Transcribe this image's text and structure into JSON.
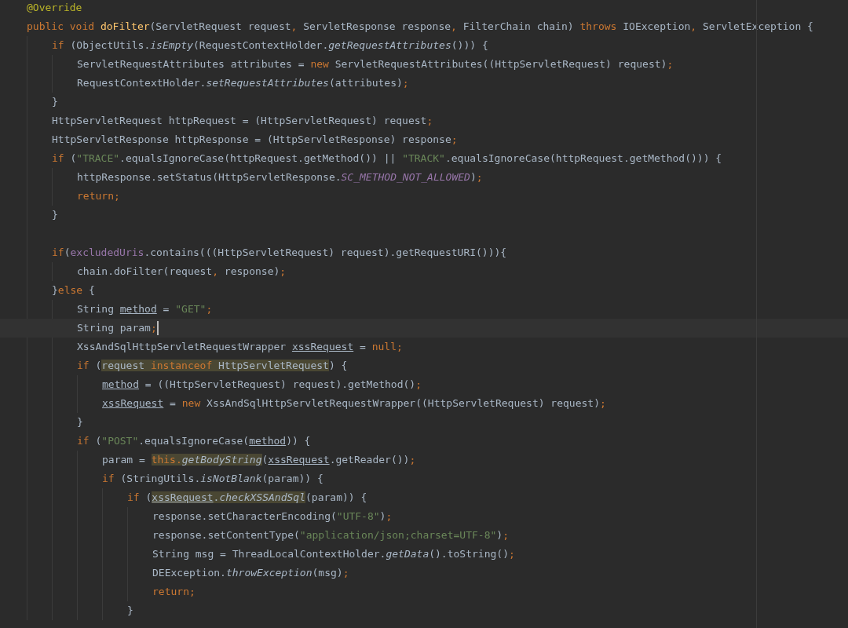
{
  "editor": {
    "lines": [
      {
        "kind": "code",
        "tokens": [
          {
            "text": "@Override",
            "kind": "anno"
          }
        ]
      },
      {
        "kind": "code",
        "tokens": [
          {
            "text": "public void ",
            "kind": "kw"
          },
          {
            "text": "doFilter",
            "kind": "decl"
          },
          {
            "text": "(ServletRequest request",
            "kind": "plain"
          },
          {
            "text": ", ",
            "kind": "punct"
          },
          {
            "text": "ServletResponse response",
            "kind": "plain"
          },
          {
            "text": ", ",
            "kind": "punct"
          },
          {
            "text": "FilterChain chain) ",
            "kind": "plain"
          },
          {
            "text": "throws ",
            "kind": "kw"
          },
          {
            "text": "IOException",
            "kind": "plain"
          },
          {
            "text": ", ",
            "kind": "punct"
          },
          {
            "text": "ServletException {",
            "kind": "plain"
          }
        ],
        "children": [
          {
            "kind": "code",
            "tokens": [
              {
                "text": "if ",
                "kind": "kw"
              },
              {
                "text": "(ObjectUtils.",
                "kind": "plain"
              },
              {
                "text": "isEmpty",
                "kind": "italic"
              },
              {
                "text": "(RequestContextHolder.",
                "kind": "plain"
              },
              {
                "text": "getRequestAttributes",
                "kind": "italic"
              },
              {
                "text": "())) {",
                "kind": "plain"
              }
            ],
            "children": [
              {
                "kind": "code",
                "tokens": [
                  {
                    "text": "ServletRequestAttributes attributes = ",
                    "kind": "plain"
                  },
                  {
                    "text": "new ",
                    "kind": "kw"
                  },
                  {
                    "text": "ServletRequestAttributes((HttpServletRequest) request)",
                    "kind": "plain"
                  },
                  {
                    "text": ";",
                    "kind": "punct"
                  }
                ]
              },
              {
                "kind": "code",
                "tokens": [
                  {
                    "text": "RequestContextHolder.",
                    "kind": "plain"
                  },
                  {
                    "text": "setRequestAttributes",
                    "kind": "italic"
                  },
                  {
                    "text": "(attributes)",
                    "kind": "plain"
                  },
                  {
                    "text": ";",
                    "kind": "punct"
                  }
                ]
              }
            ]
          },
          {
            "kind": "code",
            "tokens": [
              {
                "text": "}",
                "kind": "plain"
              }
            ]
          },
          {
            "kind": "code",
            "tokens": [
              {
                "text": "HttpServletRequest httpRequest = (HttpServletRequest) request",
                "kind": "plain"
              },
              {
                "text": ";",
                "kind": "punct"
              }
            ]
          },
          {
            "kind": "code",
            "tokens": [
              {
                "text": "HttpServletResponse httpResponse = (HttpServletResponse) response",
                "kind": "plain"
              },
              {
                "text": ";",
                "kind": "punct"
              }
            ]
          },
          {
            "kind": "code",
            "tokens": [
              {
                "text": "if ",
                "kind": "kw"
              },
              {
                "text": "(",
                "kind": "plain"
              },
              {
                "text": "\"TRACE\"",
                "kind": "str"
              },
              {
                "text": ".equalsIgnoreCase(httpRequest.getMethod()) || ",
                "kind": "plain"
              },
              {
                "text": "\"TRACK\"",
                "kind": "str"
              },
              {
                "text": ".equalsIgnoreCase(httpRequest.getMethod())) {",
                "kind": "plain"
              }
            ],
            "children": [
              {
                "kind": "code",
                "tokens": [
                  {
                    "text": "httpResponse.setStatus(HttpServletResponse.",
                    "kind": "plain"
                  },
                  {
                    "text": "SC_METHOD_NOT_ALLOWED",
                    "kind": "const"
                  },
                  {
                    "text": ")",
                    "kind": "plain"
                  },
                  {
                    "text": ";",
                    "kind": "punct"
                  }
                ]
              },
              {
                "kind": "code",
                "tokens": [
                  {
                    "text": "return;",
                    "kind": "kw"
                  }
                ]
              }
            ]
          },
          {
            "kind": "code",
            "tokens": [
              {
                "text": "}",
                "kind": "plain"
              }
            ]
          },
          {
            "kind": "blank"
          },
          {
            "kind": "code",
            "tokens": [
              {
                "text": "if",
                "kind": "kw"
              },
              {
                "text": "(",
                "kind": "plain"
              },
              {
                "text": "excludedUris",
                "kind": "field"
              },
              {
                "text": ".contains(((HttpServletRequest) request).getRequestURI())){",
                "kind": "plain"
              }
            ],
            "children": [
              {
                "kind": "code",
                "tokens": [
                  {
                    "text": "chain.doFilter(request",
                    "kind": "plain"
                  },
                  {
                    "text": ", ",
                    "kind": "punct"
                  },
                  {
                    "text": "response)",
                    "kind": "plain"
                  },
                  {
                    "text": ";",
                    "kind": "punct"
                  }
                ]
              }
            ]
          },
          {
            "kind": "code",
            "tokens": [
              {
                "text": "}",
                "kind": "plain"
              },
              {
                "text": "else ",
                "kind": "kw"
              },
              {
                "text": "{",
                "kind": "plain"
              }
            ],
            "children": [
              {
                "kind": "code",
                "tokens": [
                  {
                    "text": "String ",
                    "kind": "plain"
                  },
                  {
                    "text": "method",
                    "kind": "local"
                  },
                  {
                    "text": " = ",
                    "kind": "plain"
                  },
                  {
                    "text": "\"GET\"",
                    "kind": "str"
                  },
                  {
                    "text": ";",
                    "kind": "punct"
                  }
                ]
              },
              {
                "kind": "current",
                "tokens": [
                  {
                    "text": "String param",
                    "kind": "plain"
                  },
                  {
                    "text": ";",
                    "kind": "punct"
                  }
                ]
              },
              {
                "kind": "code",
                "tokens": [
                  {
                    "text": "XssAndSqlHttpServletRequestWrapper ",
                    "kind": "plain"
                  },
                  {
                    "text": "xssRequest",
                    "kind": "local"
                  },
                  {
                    "text": " = ",
                    "kind": "plain"
                  },
                  {
                    "text": "null;",
                    "kind": "kw"
                  }
                ]
              },
              {
                "kind": "code",
                "tokens": [
                  {
                    "text": "if ",
                    "kind": "kw"
                  },
                  {
                    "text": "(",
                    "kind": "plain"
                  },
                  {
                    "kind": "usage",
                    "tokens": [
                      {
                        "text": "request ",
                        "kind": "plain"
                      },
                      {
                        "text": "instanceof ",
                        "kind": "kw"
                      },
                      {
                        "text": "HttpServletRequest",
                        "kind": "plain"
                      }
                    ]
                  },
                  {
                    "text": ") {",
                    "kind": "plain"
                  }
                ],
                "children": [
                  {
                    "kind": "code",
                    "tokens": [
                      {
                        "text": "method",
                        "kind": "local"
                      },
                      {
                        "text": " = ((HttpServletRequest) request).getMethod()",
                        "kind": "plain"
                      },
                      {
                        "text": ";",
                        "kind": "punct"
                      }
                    ]
                  },
                  {
                    "kind": "code",
                    "tokens": [
                      {
                        "text": "xssRequest",
                        "kind": "local"
                      },
                      {
                        "text": " = ",
                        "kind": "plain"
                      },
                      {
                        "text": "new ",
                        "kind": "kw"
                      },
                      {
                        "text": "XssAndSqlHttpServletRequestWrapper((HttpServletRequest) request)",
                        "kind": "plain"
                      },
                      {
                        "text": ";",
                        "kind": "punct"
                      }
                    ]
                  }
                ]
              },
              {
                "kind": "code",
                "tokens": [
                  {
                    "text": "}",
                    "kind": "plain"
                  }
                ]
              },
              {
                "kind": "code",
                "tokens": [
                  {
                    "text": "if ",
                    "kind": "kw"
                  },
                  {
                    "text": "(",
                    "kind": "plain"
                  },
                  {
                    "text": "\"POST\"",
                    "kind": "str"
                  },
                  {
                    "text": ".equalsIgnoreCase(",
                    "kind": "plain"
                  },
                  {
                    "text": "method",
                    "kind": "local"
                  },
                  {
                    "text": ")) {",
                    "kind": "plain"
                  }
                ],
                "children": [
                  {
                    "kind": "code",
                    "tokens": [
                      {
                        "text": "param = ",
                        "kind": "plain"
                      },
                      {
                        "kind": "usage",
                        "tokens": [
                          {
                            "text": "this.",
                            "kind": "kw"
                          },
                          {
                            "text": "getBodyString",
                            "kind": "italic"
                          }
                        ]
                      },
                      {
                        "text": "(",
                        "kind": "plain"
                      },
                      {
                        "text": "xssRequest",
                        "kind": "local"
                      },
                      {
                        "text": ".getReader())",
                        "kind": "plain"
                      },
                      {
                        "text": ";",
                        "kind": "punct"
                      }
                    ]
                  },
                  {
                    "kind": "code",
                    "tokens": [
                      {
                        "text": "if ",
                        "kind": "kw"
                      },
                      {
                        "text": "(StringUtils.",
                        "kind": "plain"
                      },
                      {
                        "text": "isNotBlank",
                        "kind": "italic"
                      },
                      {
                        "text": "(param)) {",
                        "kind": "plain"
                      }
                    ],
                    "children": [
                      {
                        "kind": "code",
                        "tokens": [
                          {
                            "text": "if ",
                            "kind": "kw"
                          },
                          {
                            "text": "(",
                            "kind": "plain"
                          },
                          {
                            "kind": "usage",
                            "tokens": [
                              {
                                "text": "xssRequest",
                                "kind": "local"
                              },
                              {
                                "text": ".",
                                "kind": "plain"
                              },
                              {
                                "text": "checkXSSAndSql",
                                "kind": "italic"
                              }
                            ]
                          },
                          {
                            "text": "(param)) {",
                            "kind": "plain"
                          }
                        ],
                        "children": [
                          {
                            "kind": "code",
                            "tokens": [
                              {
                                "text": "response.setCharacterEncoding(",
                                "kind": "plain"
                              },
                              {
                                "text": "\"UTF-8\"",
                                "kind": "str"
                              },
                              {
                                "text": ")",
                                "kind": "plain"
                              },
                              {
                                "text": ";",
                                "kind": "punct"
                              }
                            ]
                          },
                          {
                            "kind": "code",
                            "tokens": [
                              {
                                "text": "response.setContentType(",
                                "kind": "plain"
                              },
                              {
                                "text": "\"application/json;charset=UTF-8\"",
                                "kind": "str"
                              },
                              {
                                "text": ")",
                                "kind": "plain"
                              },
                              {
                                "text": ";",
                                "kind": "punct"
                              }
                            ]
                          },
                          {
                            "kind": "code",
                            "tokens": [
                              {
                                "text": "String msg = ThreadLocalContextHolder.",
                                "kind": "plain"
                              },
                              {
                                "text": "getData",
                                "kind": "italic"
                              },
                              {
                                "text": "().toString()",
                                "kind": "plain"
                              },
                              {
                                "text": ";",
                                "kind": "punct"
                              }
                            ]
                          },
                          {
                            "kind": "code",
                            "tokens": [
                              {
                                "text": "DEException.",
                                "kind": "plain"
                              },
                              {
                                "text": "throwException",
                                "kind": "italic"
                              },
                              {
                                "text": "(msg)",
                                "kind": "plain"
                              },
                              {
                                "text": ";",
                                "kind": "punct"
                              }
                            ]
                          },
                          {
                            "kind": "code",
                            "tokens": [
                              {
                                "text": "return;",
                                "kind": "kw"
                              }
                            ]
                          }
                        ]
                      },
                      {
                        "kind": "code",
                        "tokens": [
                          {
                            "text": "}",
                            "kind": "plain"
                          }
                        ]
                      }
                    ]
                  }
                ]
              }
            ]
          }
        ]
      }
    ]
  }
}
